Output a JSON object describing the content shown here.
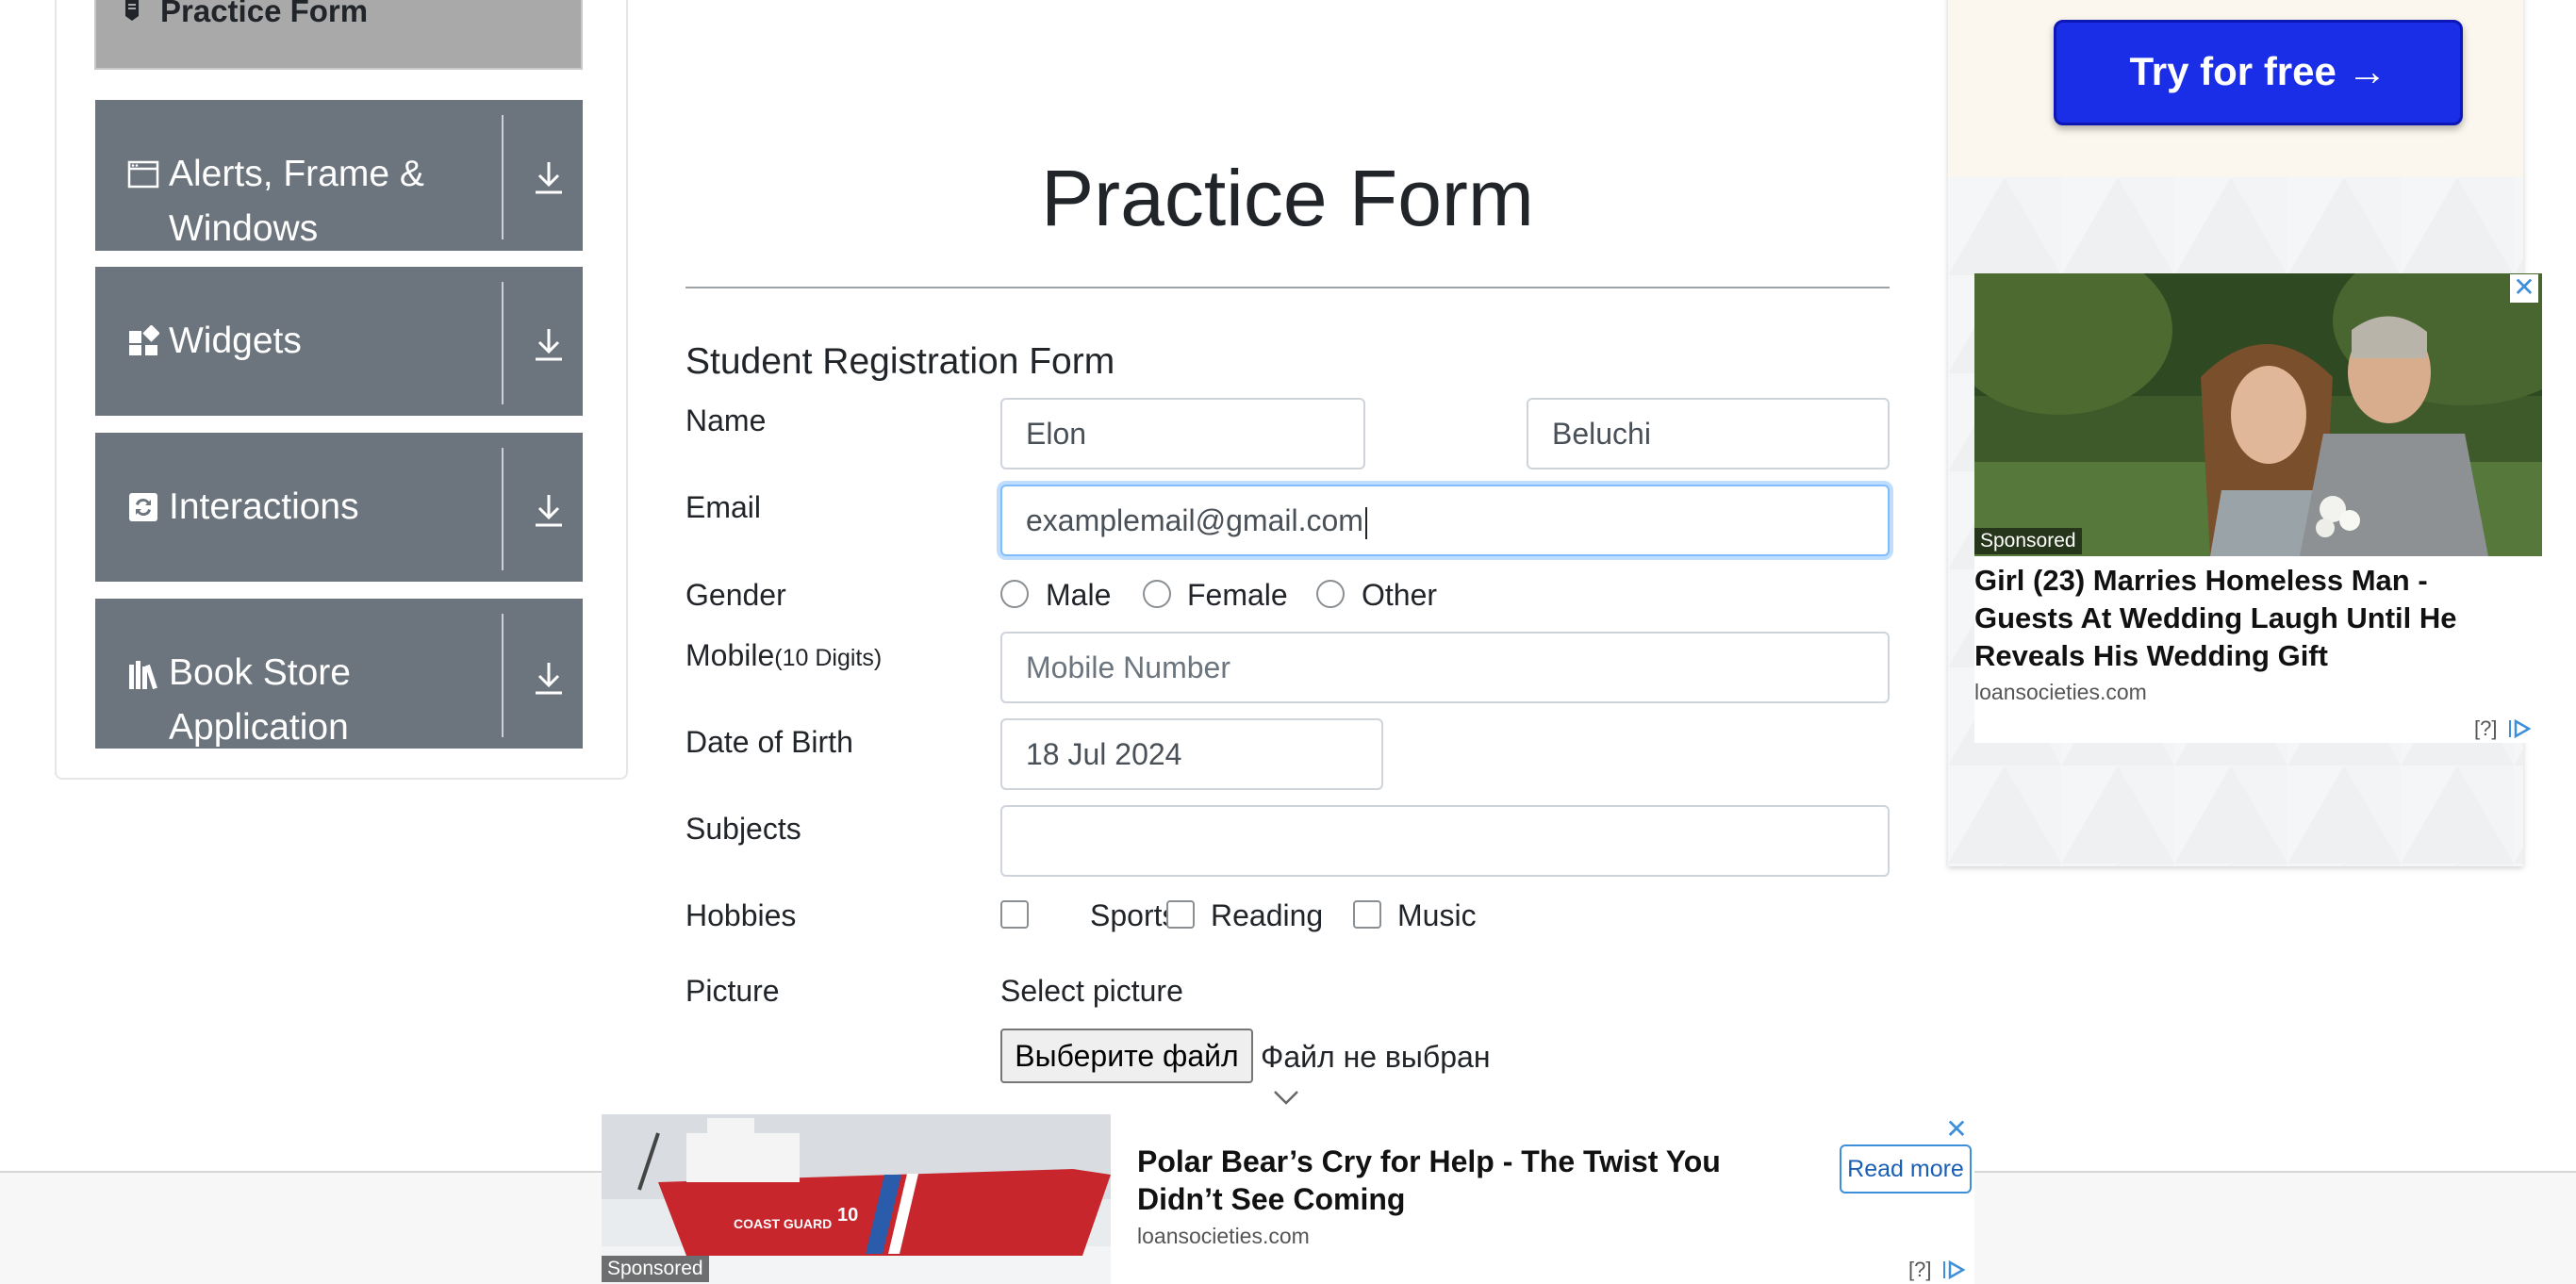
{
  "sidebar": {
    "active_item": "Practice Form",
    "groups": [
      {
        "label_line1": "Alerts, Frame &",
        "label_line2": "Windows"
      },
      {
        "label_line1": "Widgets"
      },
      {
        "label_line1": "Interactions"
      },
      {
        "label_line1": "Book Store",
        "label_line2": "Application"
      }
    ]
  },
  "page": {
    "title": "Practice Form",
    "subtitle": "Student Registration Form"
  },
  "form": {
    "name_label": "Name",
    "first_name": "Elon",
    "last_name": "Beluchi",
    "email_label": "Email",
    "email_value": "examplemail@gmail.com",
    "gender_label": "Gender",
    "gender_options": [
      "Male",
      "Female",
      "Other"
    ],
    "mobile_label": "Mobile",
    "mobile_hint": "(10 Digits)",
    "mobile_placeholder": "Mobile Number",
    "dob_label": "Date of Birth",
    "dob_value": "18 Jul 2024",
    "subjects_label": "Subjects",
    "hobbies_label": "Hobbies",
    "hobby_options": [
      "Sports",
      "Reading",
      "Music"
    ],
    "picture_label": "Picture",
    "select_picture": "Select picture",
    "file_button": "Выберите файл",
    "file_status": "Файл не выбран"
  },
  "ads": {
    "try_button": "Try for free →",
    "right_ad": {
      "sponsored": "Sponsored",
      "headline": "Girl (23) Marries Homeless Man - Guests At Wedding Laugh Until He Reveals His Wedding Gift",
      "source": "loansocieties.com",
      "choice": "[?]"
    },
    "bottom_ad": {
      "sponsored": "Sponsored",
      "headline": "Polar Bear’s Cry for Help - The Twist You Didn’t See Coming",
      "source": "loansocieties.com",
      "read_more": "Read more",
      "choice": "[?]",
      "ship_text": "COAST GUARD",
      "ship_number": "10"
    }
  },
  "colors": {
    "sidebar_group": "#6c757d",
    "sidebar_active": "#a9a9a9",
    "focus_border": "#80bdff",
    "try_button": "#1a2ee8",
    "ad_accent": "#3e8fd9"
  }
}
